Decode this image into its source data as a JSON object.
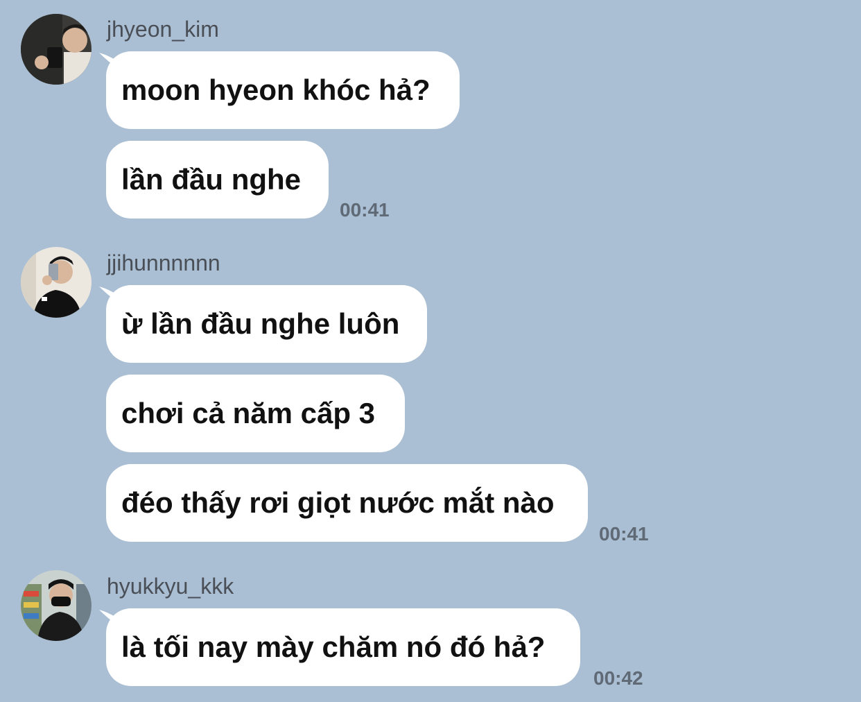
{
  "groups": [
    {
      "username": "jhyeon_kim",
      "avatar_icon": "user-photo-icon",
      "messages": [
        "moon hyeon khóc hả?",
        "lần đầu nghe"
      ],
      "time": "00:41"
    },
    {
      "username": "jjihunnnnnn",
      "avatar_icon": "user-photo-icon",
      "messages": [
        "ừ lần đầu nghe luôn",
        "chơi cả năm cấp 3",
        "đéo thấy rơi giọt nước mắt nào"
      ],
      "time": "00:41"
    },
    {
      "username": "hyukkyu_kkk",
      "avatar_icon": "user-photo-icon",
      "messages": [
        "là tối nay mày chăm nó đó hả?"
      ],
      "time": "00:42"
    }
  ],
  "colors": {
    "background": "#aabfd3",
    "bubble": "#ffffff",
    "username": "#4a4f57",
    "timestamp": "#5f6a76"
  }
}
